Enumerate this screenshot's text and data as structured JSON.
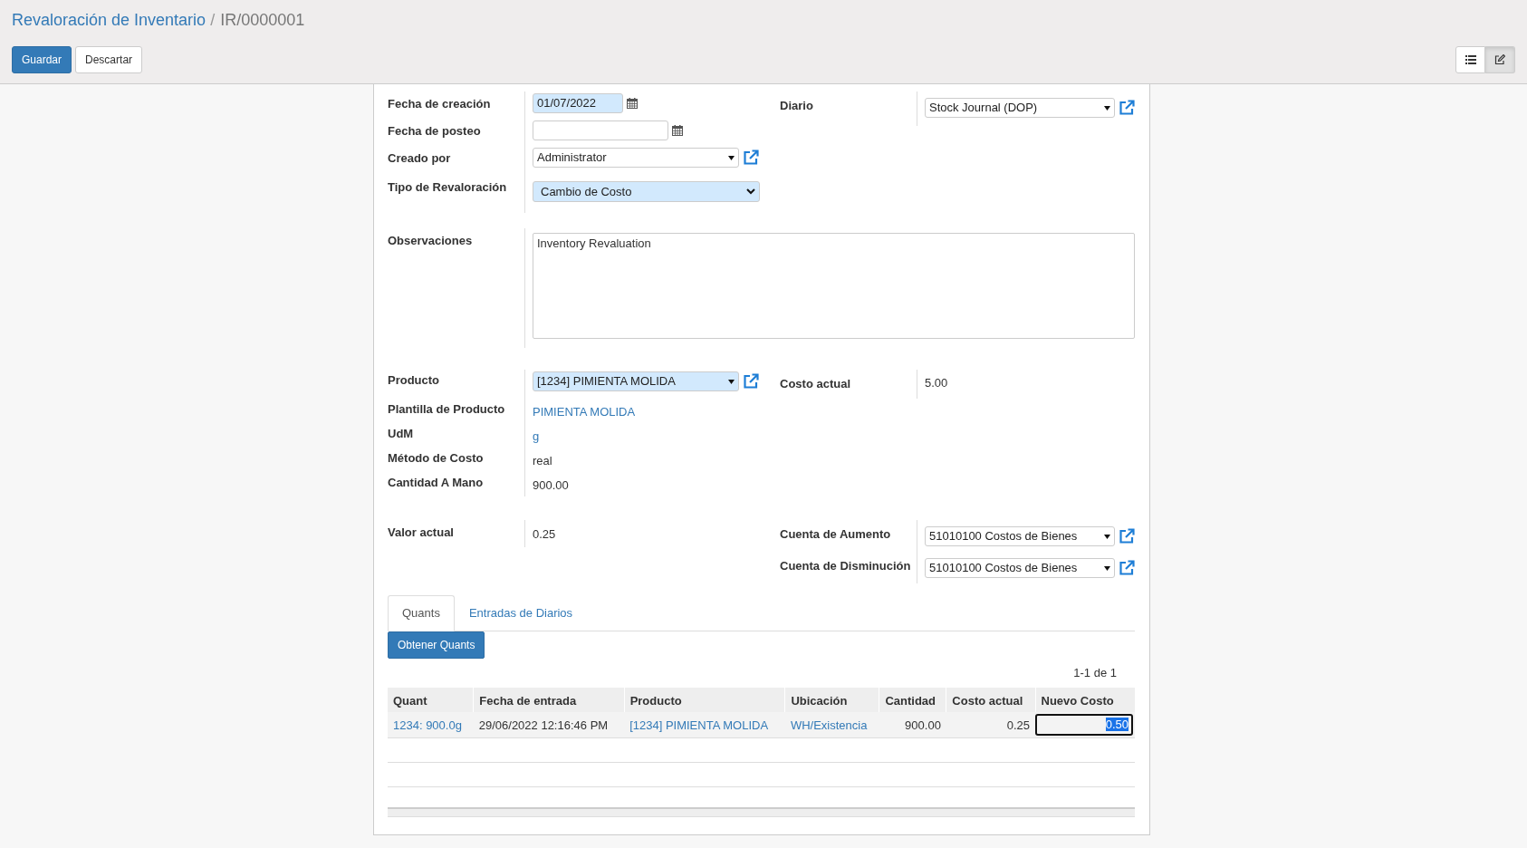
{
  "breadcrumb": [
    {
      "label": "Revaloración de Inventario",
      "kind": "link"
    },
    {
      "label": "IR/0000001",
      "kind": "current"
    }
  ],
  "buttons": [
    {
      "label": "Guardar",
      "kind": "primary"
    },
    {
      "label": "Descartar",
      "kind": "default"
    }
  ],
  "breadcrumb_separator": "/",
  "view_switcher": [
    {
      "kind": "list",
      "selected": false
    },
    {
      "kind": "form",
      "selected": true
    }
  ],
  "sections": [
    {
      "kind": "columns",
      "left": [
        {
          "label": "Fecha de creación",
          "kind": "date",
          "value": "01/07/2022",
          "required": true
        },
        {
          "label": "Fecha de posteo",
          "kind": "date",
          "required": false
        },
        {
          "label": "Creado por",
          "kind": "many2one",
          "value": "Administrator",
          "required": false
        },
        {
          "label": "Tipo de Revaloración",
          "kind": "selection",
          "value": "Cambio de Costo",
          "required": true
        }
      ],
      "right": [
        {
          "label": "Diario",
          "kind": "many2one",
          "value": "Stock Journal (DOP)",
          "required": false
        }
      ]
    },
    {
      "kind": "full",
      "fields": [
        {
          "label": "Observaciones",
          "kind": "textarea",
          "value": "Inventory Revaluation",
          "required": false
        }
      ]
    },
    {
      "kind": "columns",
      "left": [
        {
          "label": "Producto",
          "kind": "many2one",
          "value": "[1234] PIMIENTA MOLIDA",
          "required": true
        },
        {
          "label": "Plantilla de Producto",
          "kind": "link",
          "value": "PIMIENTA MOLIDA"
        },
        {
          "label": "UdM",
          "kind": "link",
          "value": "g"
        },
        {
          "label": "Método de Costo",
          "kind": "text",
          "value": "real"
        },
        {
          "label": "Cantidad A Mano",
          "kind": "text",
          "value": "900.00"
        }
      ],
      "right": [
        {
          "label": "Costo actual",
          "kind": "text",
          "value": "5.00"
        }
      ]
    },
    {
      "kind": "columns",
      "left": [
        {
          "label": "Valor actual",
          "kind": "text",
          "value": "0.25"
        }
      ],
      "right": [
        {
          "label": "Cuenta de Aumento",
          "kind": "many2one",
          "value": "51010100 Costos de Bienes",
          "required": false
        },
        {
          "label": "Cuenta de Disminución",
          "kind": "many2one",
          "value": "51010100 Costos de Bienes",
          "required": false
        }
      ]
    }
  ],
  "tabs": [
    {
      "label": "Quants",
      "selected": true
    },
    {
      "label": "Entradas de Diarios",
      "selected": false
    }
  ],
  "action_button": "Obtener Quants",
  "pager": "1-1 de 1",
  "table": {
    "columns": [
      "Quant",
      "Fecha de entrada",
      "Producto",
      "Ubicación",
      "Cantidad",
      "Costo actual",
      "Nuevo Costo"
    ],
    "rows": [
      {
        "cells": [
          {
            "text": "1234: 900.0g",
            "kind": "link"
          },
          {
            "text": "29/06/2022 12:16:46 PM",
            "kind": "text"
          },
          {
            "text": "[1234] PIMIENTA MOLIDA",
            "kind": "link"
          },
          {
            "text": "WH/Existencia",
            "kind": "link"
          },
          {
            "text": "900.00",
            "kind": "number"
          },
          {
            "text": "0.25",
            "kind": "number"
          },
          {
            "text": "0.50",
            "kind": "input",
            "text_selected": true
          }
        ]
      }
    ]
  }
}
